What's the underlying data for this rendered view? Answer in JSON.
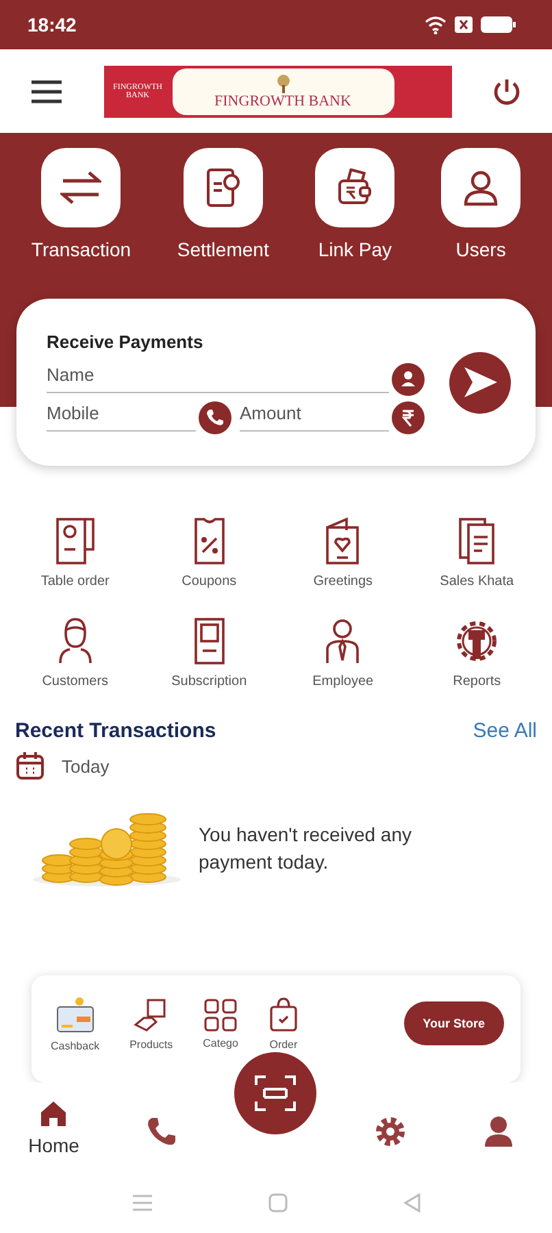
{
  "status_bar": {
    "time": "18:42"
  },
  "banner": {
    "left": "FINGROWTH BANK",
    "title": "FINGROWTH BANK"
  },
  "quick_actions": [
    {
      "label": "Transaction",
      "kind": "transfer"
    },
    {
      "label": "Settlement",
      "kind": "settle"
    },
    {
      "label": "Link Pay",
      "kind": "wallet"
    },
    {
      "label": "Users",
      "kind": "user"
    }
  ],
  "receive_payments": {
    "title": "Receive Payments",
    "fields": [
      {
        "placeholder": "Name",
        "kind": "person"
      },
      {
        "placeholder": "Mobile",
        "kind": "phone"
      },
      {
        "placeholder": "Amount",
        "kind": "rupee"
      }
    ]
  },
  "services": [
    {
      "label": "Table order",
      "kind": "doc"
    },
    {
      "label": "Coupons",
      "kind": "coupon"
    },
    {
      "label": "Greetings",
      "kind": "card"
    },
    {
      "label": "Sales Khata",
      "kind": "pages"
    },
    {
      "label": "Customers",
      "kind": "person"
    },
    {
      "label": "Subscription",
      "kind": "tablet"
    },
    {
      "label": "Employee",
      "kind": "employee"
    },
    {
      "label": "Reports",
      "kind": "gear"
    }
  ],
  "recent": {
    "title": "Recent Transactions",
    "see_all": "See All",
    "period": "Today",
    "empty": "You haven't received any payment today."
  },
  "shortcuts": [
    {
      "label": "Cashback",
      "kind": "cashback"
    },
    {
      "label": "Products",
      "kind": "box"
    },
    {
      "label": "Catego",
      "kind": "grid"
    },
    {
      "label": "Order",
      "kind": "bag"
    }
  ],
  "store_button": "Your Store",
  "nav": [
    {
      "label": "Home",
      "kind": "home",
      "selected": true
    },
    {
      "kind": "phone",
      "selected": false
    },
    {
      "kind": "gear",
      "selected": false
    },
    {
      "kind": "user",
      "selected": false
    }
  ]
}
